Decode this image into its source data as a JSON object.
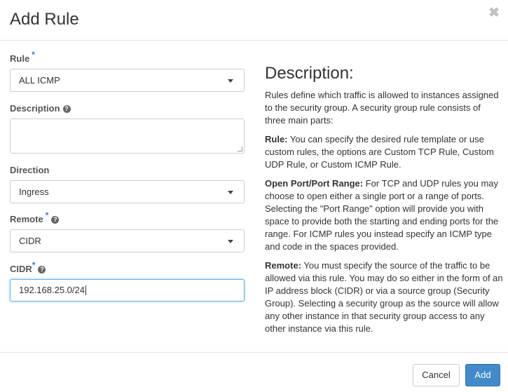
{
  "modal": {
    "title": "Add Rule",
    "close_glyph": "✖"
  },
  "form": {
    "required_mark": "*",
    "rule": {
      "label": "Rule",
      "value": "ALL ICMP"
    },
    "description": {
      "label": "Description",
      "value": ""
    },
    "direction": {
      "label": "Direction",
      "value": "Ingress"
    },
    "remote": {
      "label": "Remote",
      "value": "CIDR"
    },
    "cidr": {
      "label": "CIDR",
      "value": "192.168.25.0/24"
    }
  },
  "help_text": {
    "title": "Description:",
    "intro": "Rules define which traffic is allowed to instances assigned to the security group. A security group rule consists of three main parts:",
    "rule_term": "Rule:",
    "rule_text": " You can specify the desired rule template or use custom rules, the options are Custom TCP Rule, Custom UDP Rule, or Custom ICMP Rule.",
    "port_term": "Open Port/Port Range:",
    "port_text": " For TCP and UDP rules you may choose to open either a single port or a range of ports. Selecting the \"Port Range\" option will provide you with space to provide both the starting and ending ports for the range. For ICMP rules you instead specify an ICMP type and code in the spaces provided.",
    "remote_term": "Remote:",
    "remote_text": " You must specify the source of the traffic to be allowed via this rule. You may do so either in the form of an IP address block (CIDR) or via a source group (Security Group). Selecting a security group as the source will allow any other instance in that security group access to any other instance via this rule."
  },
  "footer": {
    "cancel_label": "Cancel",
    "add_label": "Add"
  },
  "colors": {
    "primary": "#428bca",
    "required": "#3f78c2",
    "focus_border": "#66afe9"
  },
  "icons": {
    "close": "close-icon",
    "help": "question-circle-icon",
    "dropdown": "caret-down-icon"
  }
}
